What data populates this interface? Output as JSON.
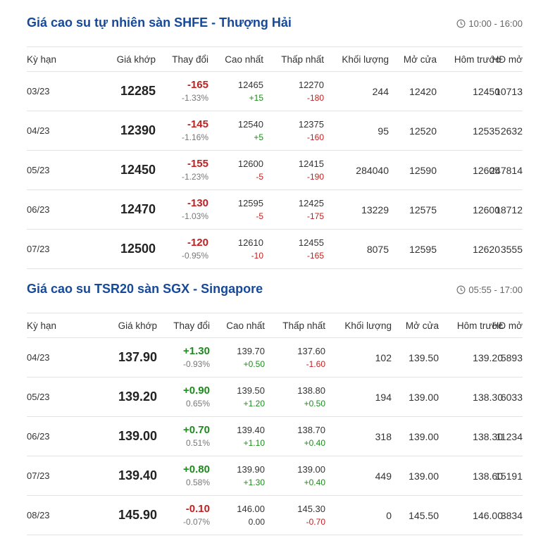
{
  "colors": {
    "title": "#17499a",
    "up": "#1e8a1e",
    "down": "#c21f1f"
  },
  "shfe": {
    "title": "Giá cao su tự nhiên sàn SHFE - Thượng Hải",
    "time": "10:00 - 16:00",
    "time_icon": "clock-icon",
    "columns": [
      "Kỳ hạn",
      "Giá khớp",
      "Thay đổi",
      "Cao nhất",
      "Thấp nhất",
      "Khối lượng",
      "Mở cửa",
      "Hôm trước",
      "HĐ mở"
    ],
    "rows": [
      {
        "term": "03/23",
        "price": "12285",
        "change": "-165",
        "change_pct": "-1.33%",
        "high": "12465",
        "high_chg": "+15",
        "low": "12270",
        "low_chg": "-180",
        "volume": "244",
        "open": "12420",
        "prev": "12450",
        "oi": "10713"
      },
      {
        "term": "04/23",
        "price": "12390",
        "change": "-145",
        "change_pct": "-1.16%",
        "high": "12540",
        "high_chg": "+5",
        "low": "12375",
        "low_chg": "-160",
        "volume": "95",
        "open": "12520",
        "prev": "12535",
        "oi": "2632"
      },
      {
        "term": "05/23",
        "price": "12450",
        "change": "-155",
        "change_pct": "-1.23%",
        "high": "12600",
        "high_chg": "-5",
        "low": "12415",
        "low_chg": "-190",
        "volume": "284040",
        "open": "12590",
        "prev": "12605",
        "oi": "247814"
      },
      {
        "term": "06/23",
        "price": "12470",
        "change": "-130",
        "change_pct": "-1.03%",
        "high": "12595",
        "high_chg": "-5",
        "low": "12425",
        "low_chg": "-175",
        "volume": "13229",
        "open": "12575",
        "prev": "12600",
        "oi": "18712"
      },
      {
        "term": "07/23",
        "price": "12500",
        "change": "-120",
        "change_pct": "-0.95%",
        "high": "12610",
        "high_chg": "-10",
        "low": "12455",
        "low_chg": "-165",
        "volume": "8075",
        "open": "12595",
        "prev": "12620",
        "oi": "3555"
      }
    ]
  },
  "sgx": {
    "title": "Giá cao su TSR20 sàn SGX - Singapore",
    "time": "05:55 - 17:00",
    "time_icon": "clock-icon",
    "columns": [
      "Kỳ hạn",
      "Giá khớp",
      "Thay đổi",
      "Cao nhất",
      "Thấp nhất",
      "Khối lượng",
      "Mở cửa",
      "Hôm trước",
      "HĐ mở"
    ],
    "rows": [
      {
        "term": "04/23",
        "price": "137.90",
        "change": "+1.30",
        "change_pct": "-0.93%",
        "high": "139.70",
        "high_chg": "+0.50",
        "low": "137.60",
        "low_chg": "-1.60",
        "volume": "102",
        "open": "139.50",
        "prev": "139.20",
        "oi": "5893"
      },
      {
        "term": "05/23",
        "price": "139.20",
        "change": "+0.90",
        "change_pct": "0.65%",
        "high": "139.50",
        "high_chg": "+1.20",
        "low": "138.80",
        "low_chg": "+0.50",
        "volume": "194",
        "open": "139.00",
        "prev": "138.30",
        "oi": "6033"
      },
      {
        "term": "06/23",
        "price": "139.00",
        "change": "+0.70",
        "change_pct": "0.51%",
        "high": "139.40",
        "high_chg": "+1.10",
        "low": "138.70",
        "low_chg": "+0.40",
        "volume": "318",
        "open": "139.00",
        "prev": "138.30",
        "oi": "11234"
      },
      {
        "term": "07/23",
        "price": "139.40",
        "change": "+0.80",
        "change_pct": "0.58%",
        "high": "139.90",
        "high_chg": "+1.30",
        "low": "139.00",
        "low_chg": "+0.40",
        "volume": "449",
        "open": "139.00",
        "prev": "138.60",
        "oi": "15191"
      },
      {
        "term": "08/23",
        "price": "145.90",
        "change": "-0.10",
        "change_pct": "-0.07%",
        "high": "146.00",
        "high_chg": "0.00",
        "low": "145.30",
        "low_chg": "-0.70",
        "volume": "0",
        "open": "145.50",
        "prev": "146.00",
        "oi": "3834"
      }
    ]
  }
}
